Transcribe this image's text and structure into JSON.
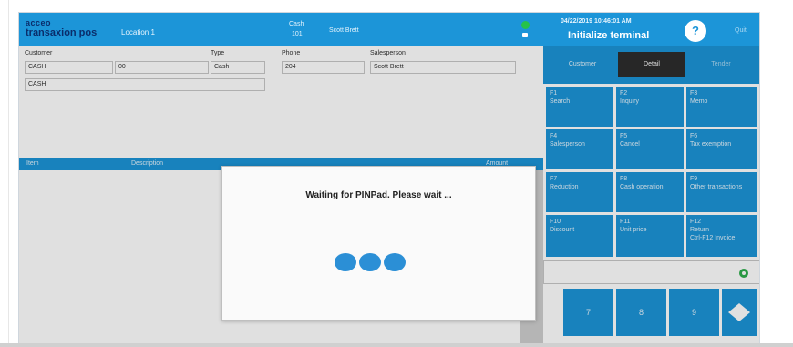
{
  "app": {
    "logo_line1": "acceo",
    "logo_line2": "transaxion pos",
    "location": "Location 1",
    "cash_label": "Cash",
    "cash_number": "101",
    "user": "Scott Brett",
    "datetime": "04/22/2019 10:46:01 AM",
    "title": "Initialize terminal",
    "help_label": "?",
    "quit_label": "Quit"
  },
  "form": {
    "customer_label": "Customer",
    "customer_value": "CASH",
    "customer_code": "00",
    "customer_name": "CASH",
    "type_label": "Type",
    "type_value": "Cash",
    "phone_label": "Phone",
    "phone_value": "204",
    "salesperson_label": "Salesperson",
    "salesperson_value": "Scott Brett"
  },
  "grid": {
    "columns": [
      "Item",
      "Description",
      "Amount"
    ]
  },
  "tabs": [
    {
      "label": "Customer"
    },
    {
      "label": "Detail"
    },
    {
      "label": "Tender"
    }
  ],
  "function_keys": [
    {
      "key": "F1",
      "label": "Search"
    },
    {
      "key": "F2",
      "label": "Inquiry"
    },
    {
      "key": "F3",
      "label": "Memo"
    },
    {
      "key": "F4",
      "label": "Salesperson"
    },
    {
      "key": "F5",
      "label": "Cancel"
    },
    {
      "key": "F6",
      "label": "Tax exemption"
    },
    {
      "key": "F7",
      "label": "Reduction"
    },
    {
      "key": "F8",
      "label": "Cash operation"
    },
    {
      "key": "F9",
      "label": "Other transactions"
    },
    {
      "key": "F10",
      "label": "Discount"
    },
    {
      "key": "F11",
      "label": "Unit price"
    },
    {
      "key": "F12",
      "label": "Return\nCtrl-F12 Invoice"
    }
  ],
  "numpad": [
    "7",
    "8",
    "9"
  ],
  "modal": {
    "message": "Waiting for PINPad. Please wait ..."
  },
  "colors": {
    "brand_blue": "#1c95d8",
    "active_tab": "#2d2d2d",
    "status_green": "#26c24b",
    "spinner_blue": "#2b8fd6"
  }
}
